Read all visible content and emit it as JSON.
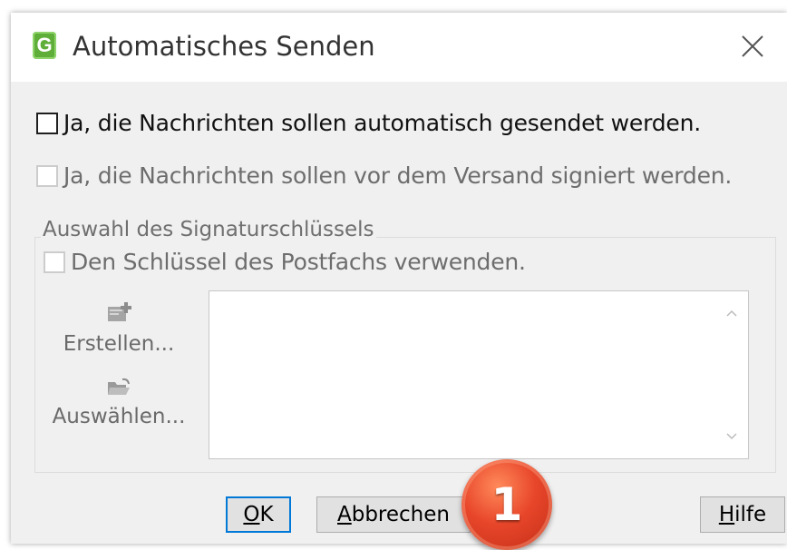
{
  "window": {
    "title": "Automatisches Senden",
    "app_icon_letter": "G"
  },
  "options": {
    "auto_send_label": "Ja, die Nachrichten sollen automatisch gesendet werden.",
    "sign_label": "Ja, die Nachrichten sollen vor dem Versand signiert werden."
  },
  "signature_group": {
    "title": "Auswahl des Signaturschlüssels",
    "use_mailbox_key_label": "Den Schlüssel des Postfachs verwenden.",
    "create_label": "Erstellen...",
    "select_label": "Auswählen..."
  },
  "buttons": {
    "ok_underlined": "O",
    "ok_rest": "K",
    "cancel_underlined": "A",
    "cancel_rest": "bbrechen",
    "help_underlined": "H",
    "help_rest": "ilfe"
  },
  "callout": {
    "number": "1"
  },
  "colors": {
    "accent": "#0078d7",
    "app_icon": "#5fae3a",
    "callout": "#e8462a"
  },
  "icons": {
    "close": "close-icon",
    "create": "new-key-icon",
    "select": "folder-open-icon"
  }
}
